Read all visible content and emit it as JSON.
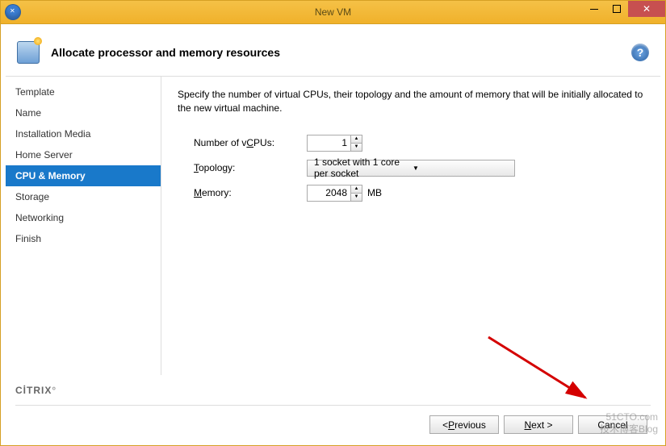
{
  "titlebar": {
    "title": "New VM"
  },
  "header": {
    "title": "Allocate processor and memory resources"
  },
  "sidebar": {
    "items": [
      {
        "label": "Template"
      },
      {
        "label": "Name"
      },
      {
        "label": "Installation Media"
      },
      {
        "label": "Home Server"
      },
      {
        "label": "CPU & Memory",
        "selected": true
      },
      {
        "label": "Storage"
      },
      {
        "label": "Networking"
      },
      {
        "label": "Finish"
      }
    ]
  },
  "content": {
    "description": "Specify the number of virtual CPUs, their topology and the amount of memory that will be initially allocated to the new virtual machine.",
    "vcpu_label_prefix": "Number of v",
    "vcpu_label_ul": "C",
    "vcpu_label_suffix": "PUs:",
    "vcpu_value": "1",
    "topology_label_ul": "T",
    "topology_label_suffix": "opology:",
    "topology_value": "1 socket with 1 core per socket",
    "memory_label_ul": "M",
    "memory_label_suffix": "emory:",
    "memory_value": "2048",
    "memory_unit": "MB"
  },
  "footer": {
    "brand": "CİTRIX",
    "previous_prefix": "< ",
    "previous_ul": "P",
    "previous_suffix": "revious",
    "next_ul": "N",
    "next_suffix": "ext >",
    "cancel": "Cancel"
  },
  "watermark": {
    "line1": "51CTO.com",
    "line2": "技术博客Blog"
  }
}
